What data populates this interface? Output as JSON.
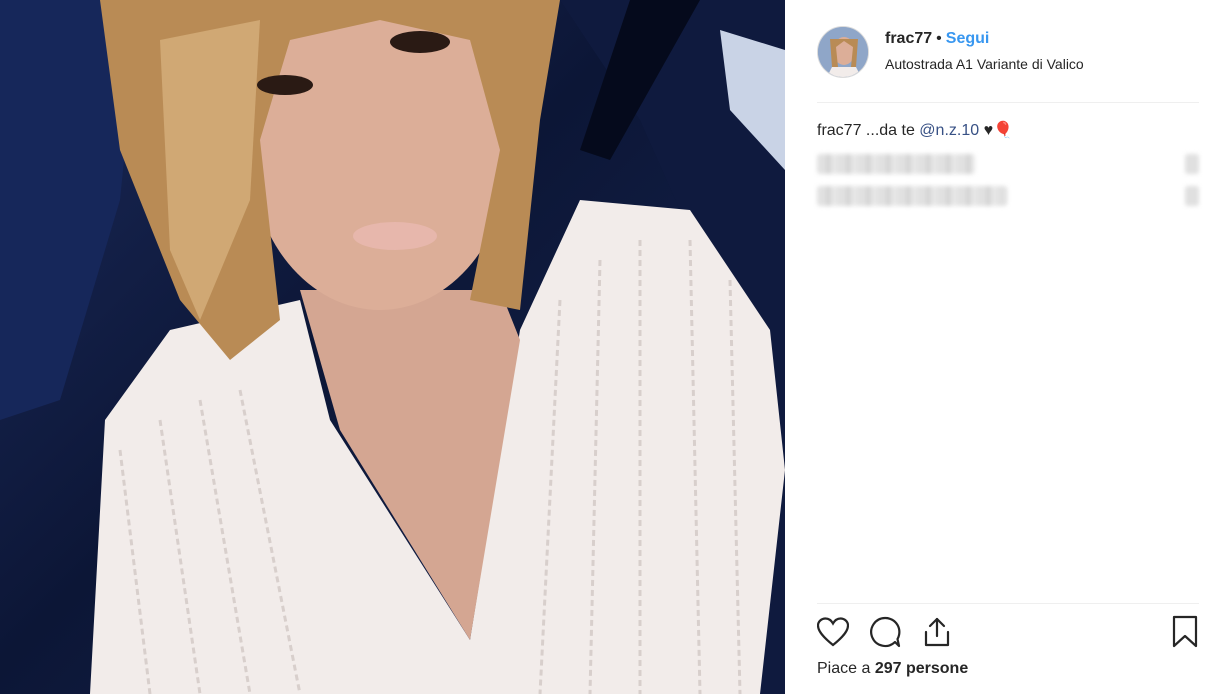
{
  "post": {
    "photo": {
      "icon": "selfie-photo",
      "description_colors": {
        "background": "#0c1636",
        "hair": "#b88a52",
        "shirt": "#f2eceb",
        "skin": "#d8aa95"
      }
    },
    "header": {
      "username": "frac77",
      "separator": "•",
      "follow_label": "Segui",
      "location": "Autostrada A1 Variante di Valico",
      "follow_color": "#3897f0"
    },
    "caption": {
      "username": "frac77",
      "text": "...da te",
      "mention": "@n.z.10",
      "emoji": "♥🎈"
    },
    "actions": {
      "like_icon": "heart-icon",
      "comment_icon": "comment-icon",
      "share_icon": "share-icon",
      "save_icon": "bookmark-icon"
    },
    "likes": {
      "prefix": "Piace a",
      "count": "297",
      "suffix": "persone"
    }
  }
}
